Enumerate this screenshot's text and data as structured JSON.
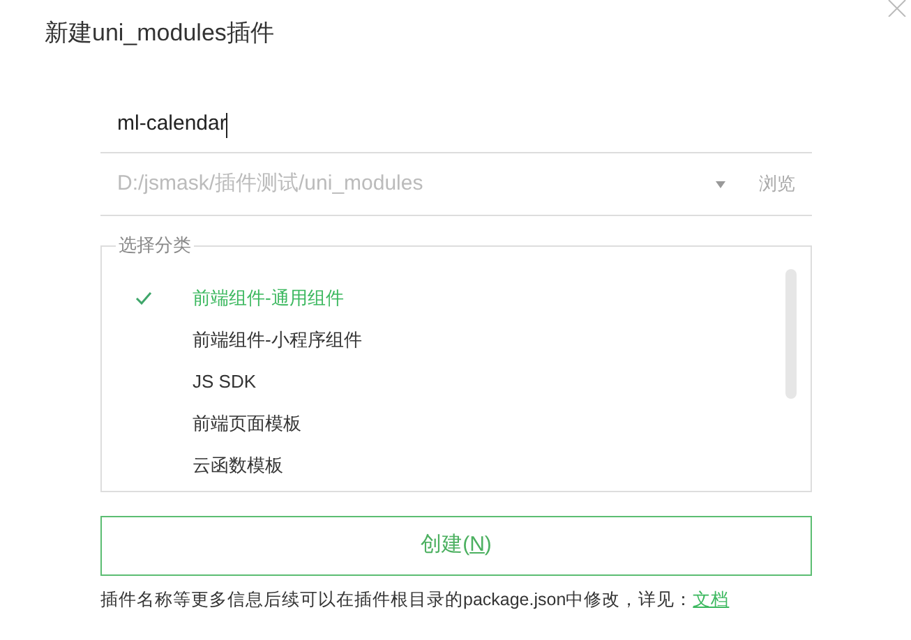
{
  "dialog": {
    "title": "新建uni_modules插件"
  },
  "name_field": {
    "value": "ml-calendar"
  },
  "path_field": {
    "placeholder": "D:/jsmask/插件测试/uni_modules",
    "browse": "浏览"
  },
  "category_group": {
    "legend": "选择分类",
    "items": [
      {
        "label": "前端组件-通用组件",
        "selected": true
      },
      {
        "label": "前端组件-小程序组件",
        "selected": false
      },
      {
        "label": "JS SDK",
        "selected": false
      },
      {
        "label": "前端页面模板",
        "selected": false
      },
      {
        "label": "云函数模板",
        "selected": false
      }
    ]
  },
  "create_button": {
    "label_parts": [
      {
        "text": "创建(",
        "underlined": false
      },
      {
        "text": "N",
        "underlined": true
      },
      {
        "text": ")",
        "underlined": false
      }
    ]
  },
  "footer": {
    "text": "插件名称等更多信息后续可以在插件根目录的package.json中修改，详见：",
    "link": "文档"
  }
}
